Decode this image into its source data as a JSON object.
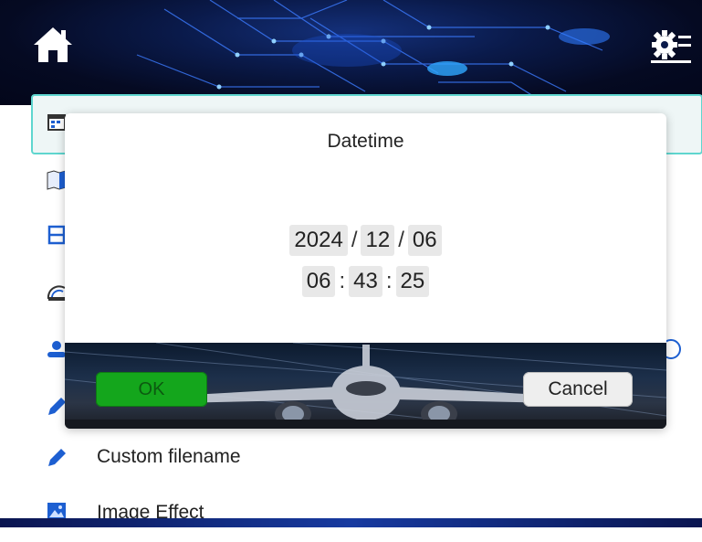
{
  "header": {
    "home_icon": "home-icon",
    "settings_icon": "settings-list-icon"
  },
  "list": {
    "items": [
      {
        "icon": "calendar-icon",
        "label": ""
      },
      {
        "icon": "map-icon",
        "label": ""
      },
      {
        "icon": "film-icon",
        "label": ""
      },
      {
        "icon": "signal-icon",
        "label": ""
      },
      {
        "icon": "user-icon",
        "label": ""
      },
      {
        "icon": "pencil-icon",
        "label": ""
      },
      {
        "icon": "pencil-icon",
        "label": "Custom filename"
      },
      {
        "icon": "image-icon",
        "label": "Image Effect"
      }
    ]
  },
  "dialog": {
    "title": "Datetime",
    "date": {
      "year": "2024",
      "month": "12",
      "day": "06",
      "separator": "/"
    },
    "time": {
      "hour": "06",
      "minute": "43",
      "second": "25",
      "separator": ":"
    },
    "ok_label": "OK",
    "cancel_label": "Cancel"
  },
  "colors": {
    "accent_teal": "#5fd6cf",
    "ok_green": "#14a61c",
    "icon_blue": "#1d5fd1",
    "header_navy": "#0a1a4a"
  }
}
